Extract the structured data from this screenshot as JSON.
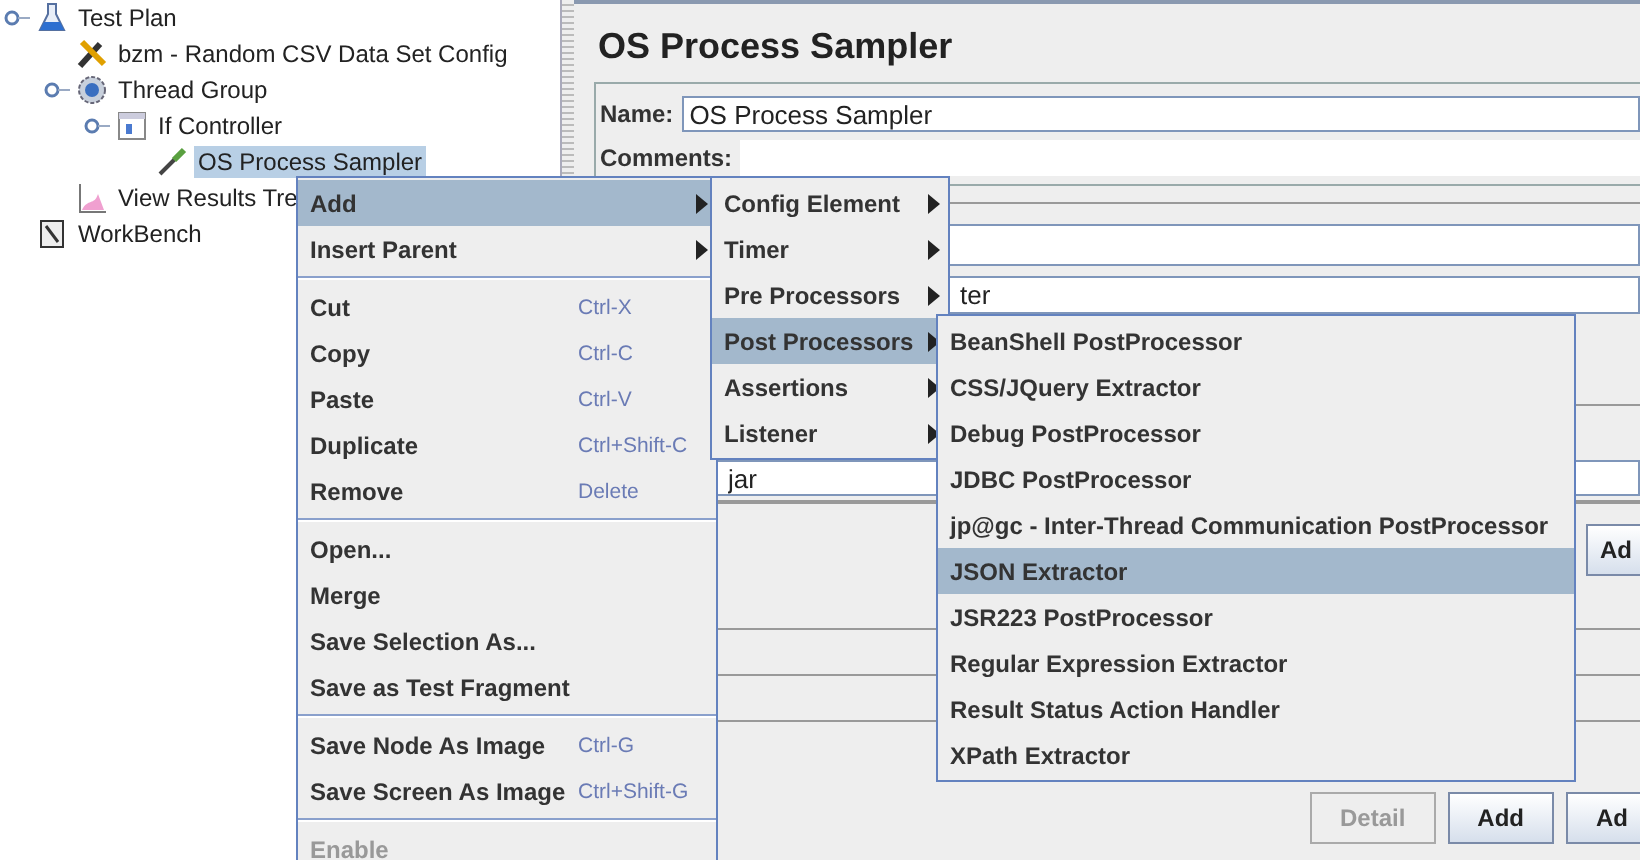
{
  "tree": [
    {
      "label": "Test Plan",
      "kind": "test_plan",
      "selected": false,
      "children": [
        {
          "label": "bzm - Random CSV Data Set Config",
          "kind": "config",
          "selected": false
        },
        {
          "label": "Thread Group",
          "kind": "thread_group",
          "selected": false,
          "children": [
            {
              "label": "If Controller",
              "kind": "controller",
              "selected": false,
              "children": [
                {
                  "label": "OS Process Sampler",
                  "kind": "sampler",
                  "selected": true
                }
              ]
            }
          ]
        },
        {
          "label": "View Results Tre",
          "kind": "listener",
          "selected": false
        }
      ]
    },
    {
      "label": "WorkBench",
      "kind": "workbench",
      "selected": false
    }
  ],
  "panel": {
    "title": "OS Process Sampler",
    "name_label": "Name:",
    "name_value": "OS Process Sampler",
    "comments_label": "Comments:",
    "field_value": "ter",
    "field_value_2": "jar",
    "side_button": "Ad",
    "buttons": [
      {
        "label": "Detail",
        "disabled": true
      },
      {
        "label": "Add",
        "disabled": false
      },
      {
        "label": "Ad",
        "disabled": false
      }
    ]
  },
  "context_menu": {
    "groups": [
      [
        {
          "label": "Add",
          "kind": "submenu",
          "selected": true,
          "disabled": false
        },
        {
          "label": "Insert Parent",
          "kind": "submenu",
          "selected": false,
          "disabled": false
        }
      ],
      [
        {
          "label": "Cut",
          "kind": "action",
          "shortcut": "Ctrl-X",
          "selected": false,
          "disabled": false
        },
        {
          "label": "Copy",
          "kind": "action",
          "shortcut": "Ctrl-C",
          "selected": false,
          "disabled": false
        },
        {
          "label": "Paste",
          "kind": "action",
          "shortcut": "Ctrl-V",
          "selected": false,
          "disabled": false
        },
        {
          "label": "Duplicate",
          "kind": "action",
          "shortcut": "Ctrl+Shift-C",
          "selected": false,
          "disabled": false
        },
        {
          "label": "Remove",
          "kind": "action",
          "shortcut": "Delete",
          "selected": false,
          "disabled": false
        }
      ],
      [
        {
          "label": "Open...",
          "kind": "action",
          "selected": false,
          "disabled": false
        },
        {
          "label": "Merge",
          "kind": "action",
          "selected": false,
          "disabled": false
        },
        {
          "label": "Save Selection As...",
          "kind": "action",
          "selected": false,
          "disabled": false
        },
        {
          "label": "Save as Test Fragment",
          "kind": "action",
          "selected": false,
          "disabled": false
        }
      ],
      [
        {
          "label": "Save Node As Image",
          "kind": "action",
          "shortcut": "Ctrl-G",
          "selected": false,
          "disabled": false
        },
        {
          "label": "Save Screen As Image",
          "kind": "action",
          "shortcut": "Ctrl+Shift-G",
          "selected": false,
          "disabled": false
        }
      ],
      [
        {
          "label": "Enable",
          "kind": "action",
          "selected": false,
          "disabled": true
        }
      ]
    ]
  },
  "add_menu": [
    {
      "label": "Config Element",
      "selected": false
    },
    {
      "label": "Timer",
      "selected": false
    },
    {
      "label": "Pre Processors",
      "selected": false
    },
    {
      "label": "Post Processors",
      "selected": true
    },
    {
      "label": "Assertions",
      "selected": false
    },
    {
      "label": "Listener",
      "selected": false
    }
  ],
  "post_processors_menu": [
    {
      "label": "BeanShell PostProcessor",
      "selected": false
    },
    {
      "label": "CSS/JQuery Extractor",
      "selected": false
    },
    {
      "label": "Debug PostProcessor",
      "selected": false
    },
    {
      "label": "JDBC PostProcessor",
      "selected": false
    },
    {
      "label": "jp@gc - Inter-Thread Communication PostProcessor",
      "selected": false
    },
    {
      "label": "JSON Extractor",
      "selected": true
    },
    {
      "label": "JSR223 PostProcessor",
      "selected": false
    },
    {
      "label": "Regular Expression Extractor",
      "selected": false
    },
    {
      "label": "Result Status Action Handler",
      "selected": false
    },
    {
      "label": "XPath Extractor",
      "selected": false
    }
  ]
}
